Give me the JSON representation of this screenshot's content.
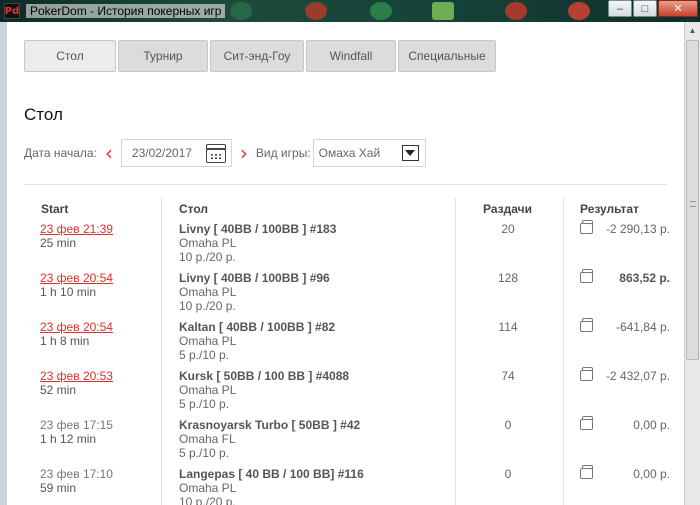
{
  "window": {
    "title": "PokerDom - История покерных игр",
    "minimize": "–",
    "maximize": "□",
    "close": "✕",
    "app_icon_text": "Pd"
  },
  "tabs": [
    {
      "label": "Стол",
      "active": true
    },
    {
      "label": "Турнир",
      "active": false
    },
    {
      "label": "Сит-энд-Гоу",
      "active": false
    },
    {
      "label": "Windfall",
      "active": false
    },
    {
      "label": "Специальные",
      "active": false
    }
  ],
  "section_title": "Стол",
  "filters": {
    "date_label": "Дата начала:",
    "date_value": "23/02/2017",
    "prev_icon": "‹",
    "next_icon": "›",
    "game_label": "Вид игры:",
    "game_value": "Омаха Хай"
  },
  "columns": {
    "start": "Start",
    "table": "Стол",
    "hands": "Раздачи",
    "result": "Результат"
  },
  "rows": [
    {
      "start": "23 фев 21:39",
      "duration": "25 min",
      "link": true,
      "table": "Livny [ 40BB / 100BB ] #183",
      "game": "Omaha PL",
      "stakes": "10 р./20 р.",
      "hands": "20",
      "result": "-2 290,13 р.",
      "bold": false
    },
    {
      "start": "23 фев 20:54",
      "duration": "1 h 10 min",
      "link": true,
      "table": "Livny [ 40BB / 100BB ] #96",
      "game": "Omaha PL",
      "stakes": "10 р./20 р.",
      "hands": "128",
      "result": "863,52 р.",
      "bold": true
    },
    {
      "start": "23 фев 20:54",
      "duration": "1 h 8 min",
      "link": true,
      "table": "Kaltan [ 40BB / 100BB ] #82",
      "game": "Omaha PL",
      "stakes": "5 р./10 р.",
      "hands": "114",
      "result": "-641,84 р.",
      "bold": false
    },
    {
      "start": "23 фев 20:53",
      "duration": "52 min",
      "link": true,
      "table": "Kursk [ 50BB / 100 BB ] #4088",
      "game": "Omaha PL",
      "stakes": "5 р./10 р.",
      "hands": "74",
      "result": "-2 432,07 р.",
      "bold": false
    },
    {
      "start": "23 фев 17:15",
      "duration": "1 h 12 min",
      "link": false,
      "table": "Krasnoyarsk Turbo [ 50BB ] #42",
      "game": "Omaha FL",
      "stakes": "5 р./10 р.",
      "hands": "0",
      "result": "0,00 р.",
      "bold": false
    },
    {
      "start": "23 фев 17:10",
      "duration": "59 min",
      "link": false,
      "table": "Langepas [ 40 BB / 100 BB] #116",
      "game": "Omaha PL",
      "stakes": "10 р./20 р.",
      "hands": "0",
      "result": "0,00 р.",
      "bold": false
    }
  ],
  "colors": {
    "accent_red": "#e0332b",
    "link_red": "#d9322a",
    "tab_bg": "#dcdcdc",
    "tab_active_bg": "#ececec"
  }
}
